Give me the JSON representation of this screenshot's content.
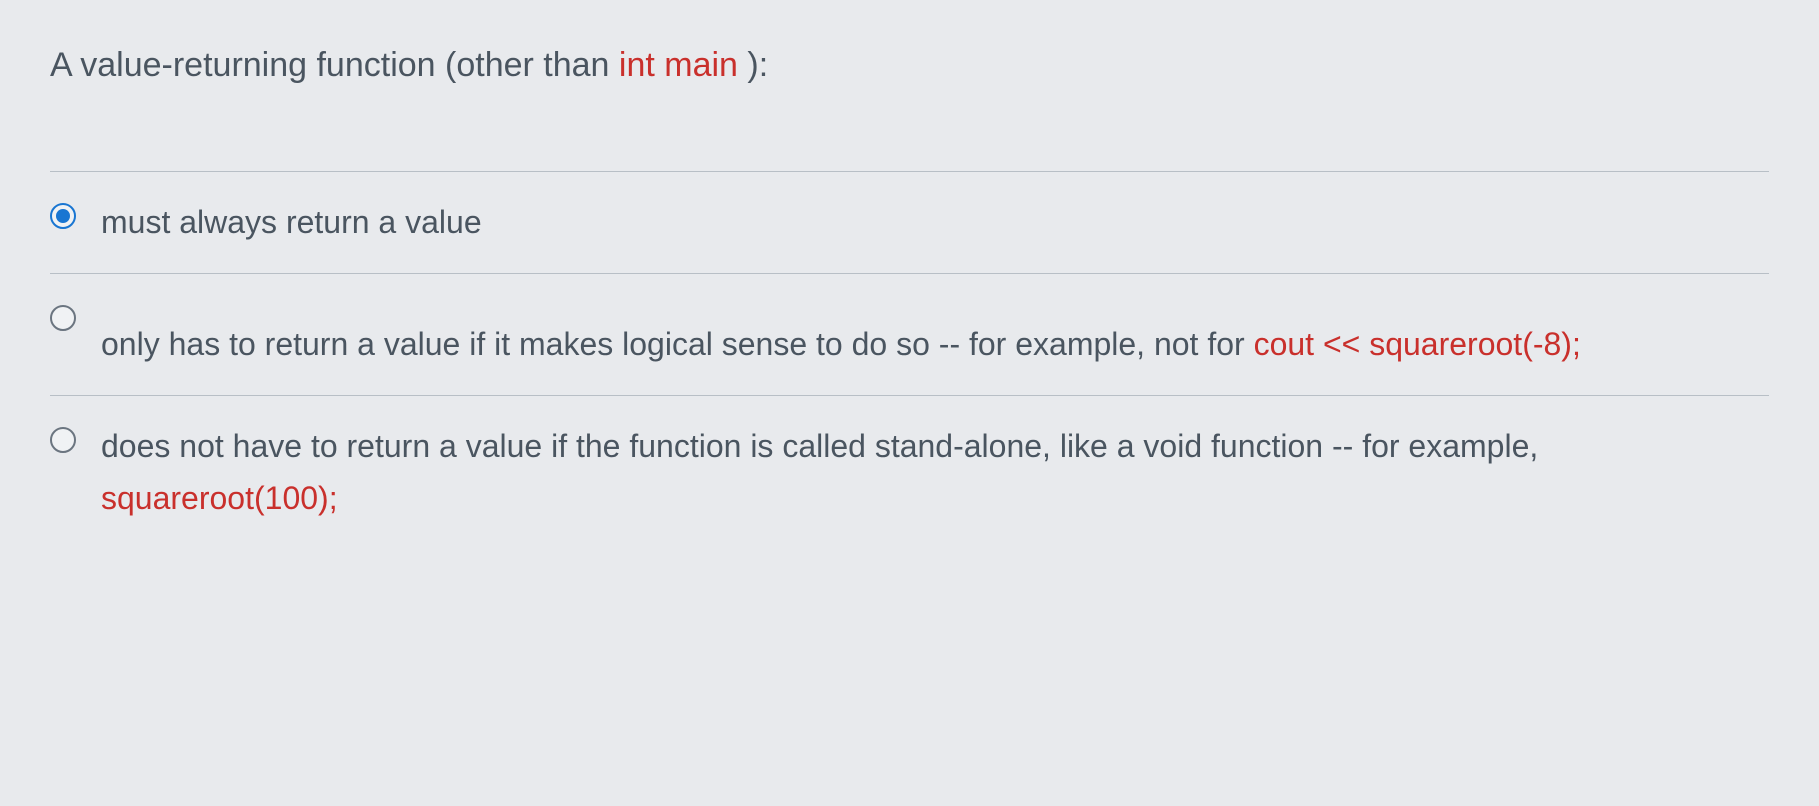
{
  "question": {
    "prefix": "A value-returning function (other than ",
    "code": "int main ",
    "suffix": "):"
  },
  "options": [
    {
      "selected": true,
      "parts": [
        {
          "text": "must always return a value",
          "code": false
        }
      ]
    },
    {
      "selected": false,
      "parts": [
        {
          "text": "only has to return a value if it makes logical sense to do so -- for example, not for ",
          "code": false
        },
        {
          "text": "cout << squareroot(-8);",
          "code": true
        }
      ]
    },
    {
      "selected": false,
      "parts": [
        {
          "text": "does not have to return a value if the function is called stand-alone, like a void function -- for example, ",
          "code": false
        },
        {
          "text": "squareroot(100);",
          "code": true
        }
      ]
    }
  ]
}
